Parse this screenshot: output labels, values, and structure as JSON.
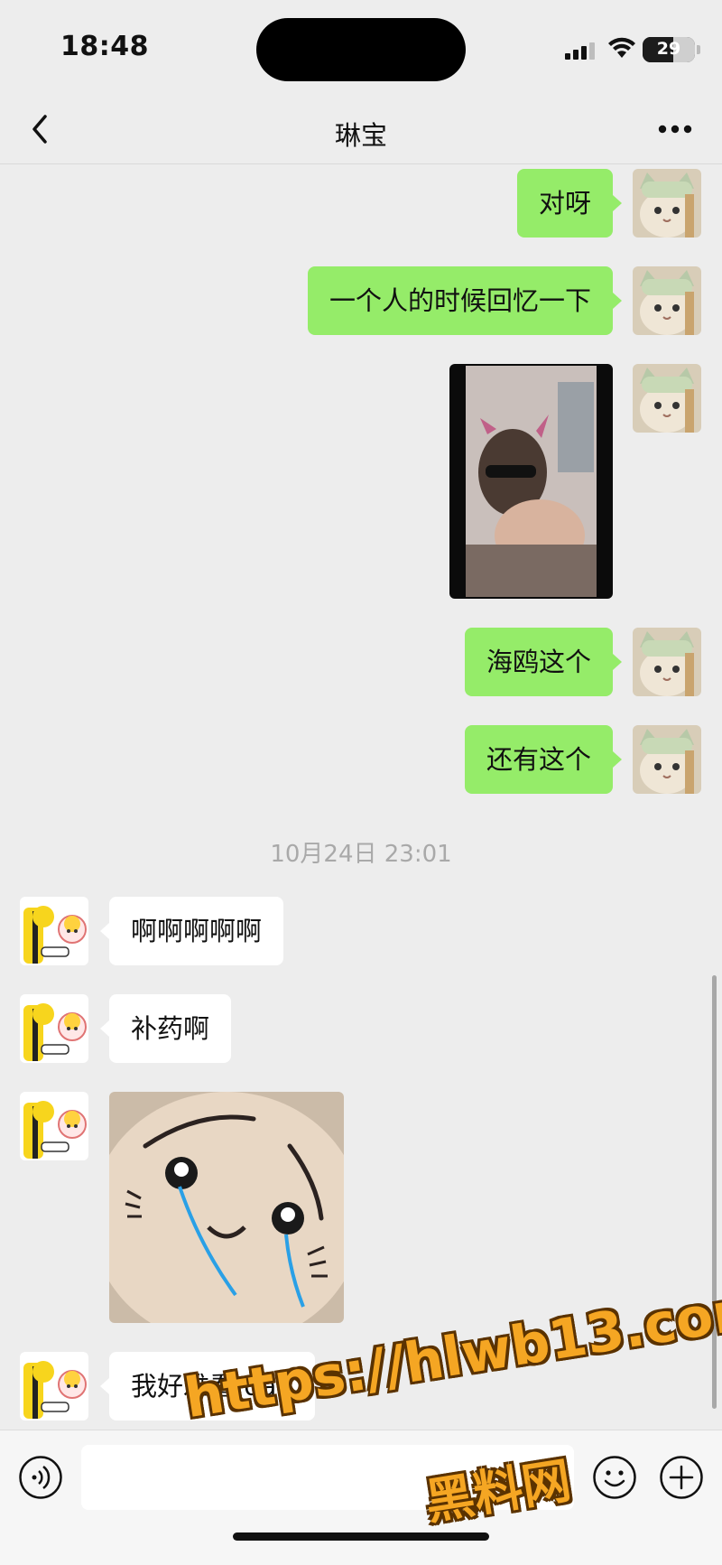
{
  "status_bar": {
    "time": "18:48",
    "battery": "29"
  },
  "nav": {
    "title": "琳宝"
  },
  "messages_top": [
    {
      "text": "对呀"
    },
    {
      "text": "一个人的时候回忆一下"
    },
    {
      "text": "海鸥这个"
    },
    {
      "text": "还有这个"
    }
  ],
  "timestamp": "10月24日 23:01",
  "messages_bottom": [
    {
      "text": "啊啊啊啊啊"
    },
    {
      "text": "补药啊"
    },
    {
      "text": "我好难看 qaq"
    }
  ],
  "watermark": {
    "url": "https://hlwb13.com",
    "name": "黑料网"
  },
  "colors": {
    "my_bubble": "#95ec69",
    "other_bubble": "#ffffff",
    "background": "#ededed"
  },
  "icons": [
    "back-icon",
    "more-icon",
    "voice-icon",
    "emoji-icon",
    "plus-icon"
  ]
}
